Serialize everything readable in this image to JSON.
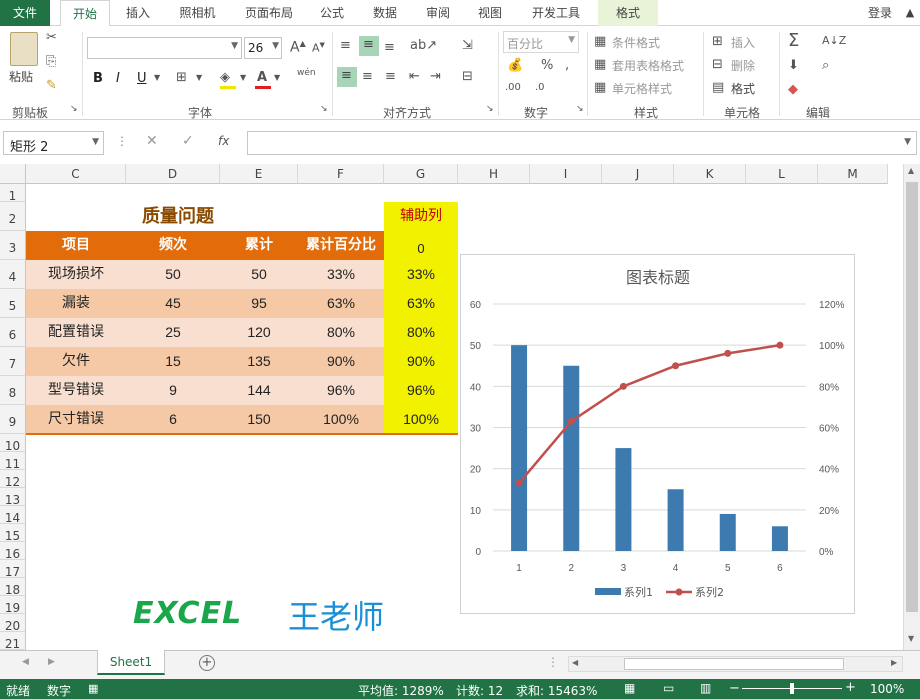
{
  "menu": {
    "file": "文件",
    "home": "开始",
    "insert": "插入",
    "camera": "照相机",
    "layout": "页面布局",
    "formula": "公式",
    "data": "数据",
    "review": "审阅",
    "view": "视图",
    "developer": "开发工具",
    "format": "格式",
    "login": "登录"
  },
  "ribbon": {
    "paste": "粘贴",
    "clipboard": "剪贴板",
    "font_group": "字体",
    "font_size": "26",
    "align_group": "对齐方式",
    "number_format": "百分比",
    "number_group": "数字",
    "cond_format": "条件格式",
    "table_format": "套用表格格式",
    "cell_style": "单元格样式",
    "styles_group": "样式",
    "insert_cell": "插入",
    "delete_cell": "删除",
    "format_cell": "格式",
    "cells_group": "单元格",
    "edit_group": "编辑",
    "bold": "B",
    "italic": "I",
    "underline": "U",
    "font_color_glyph": "A",
    "phonetic": "wén",
    "sum": "Σ",
    "percent": "%"
  },
  "formula_bar": {
    "name_box": "矩形 2",
    "fx": "fx"
  },
  "columns": [
    "C",
    "D",
    "E",
    "F",
    "G",
    "H",
    "I",
    "J",
    "K",
    "L",
    "M"
  ],
  "rows": [
    "1",
    "2",
    "3",
    "4",
    "5",
    "6",
    "7",
    "8",
    "9",
    "10",
    "11",
    "12",
    "13",
    "14",
    "15",
    "16",
    "17",
    "18",
    "19",
    "20",
    "21"
  ],
  "table": {
    "title": "质量问题",
    "helper_header": "辅助列",
    "helper_zero": "0",
    "headers": [
      "项目",
      "频次",
      "累计",
      "累计百分比"
    ],
    "rows": [
      {
        "item": "现场损坏",
        "freq": "50",
        "cum": "50",
        "pct": "33%",
        "helper": "33%"
      },
      {
        "item": "漏装",
        "freq": "45",
        "cum": "95",
        "pct": "63%",
        "helper": "63%"
      },
      {
        "item": "配置错误",
        "freq": "25",
        "cum": "120",
        "pct": "80%",
        "helper": "80%"
      },
      {
        "item": "欠件",
        "freq": "15",
        "cum": "135",
        "pct": "90%",
        "helper": "90%"
      },
      {
        "item": "型号错误",
        "freq": "9",
        "cum": "144",
        "pct": "96%",
        "helper": "96%"
      },
      {
        "item": "尺寸错误",
        "freq": "6",
        "cum": "150",
        "pct": "100%",
        "helper": "100%"
      }
    ]
  },
  "watermark": {
    "excel": "EXCEL",
    "teacher": "王老师"
  },
  "chart_data": {
    "type": "bar",
    "title": "图表标题",
    "categories": [
      "1",
      "2",
      "3",
      "4",
      "5",
      "6"
    ],
    "series": [
      {
        "name": "系列1",
        "type": "bar",
        "axis": "left",
        "values": [
          50,
          45,
          25,
          15,
          9,
          6
        ],
        "color": "#3d7ab0"
      },
      {
        "name": "系列2",
        "type": "line",
        "axis": "right",
        "values": [
          0.33,
          0.63,
          0.8,
          0.9,
          0.96,
          1.0
        ],
        "color": "#c0504d"
      }
    ],
    "left_ticks": [
      "0",
      "10",
      "20",
      "30",
      "40",
      "50",
      "60"
    ],
    "right_ticks": [
      "0%",
      "20%",
      "40%",
      "60%",
      "80%",
      "100%",
      "120%"
    ],
    "ylim": [
      0,
      60
    ],
    "y2lim": [
      0,
      1.2
    ],
    "legend": "bottom"
  },
  "sheet": {
    "tab": "Sheet1",
    "add": "+"
  },
  "status": {
    "ready": "就绪",
    "mode": "数字",
    "average": "平均值: 1289%",
    "count": "计数: 12",
    "sum": "求和: 15463%",
    "zoom": "100%"
  }
}
